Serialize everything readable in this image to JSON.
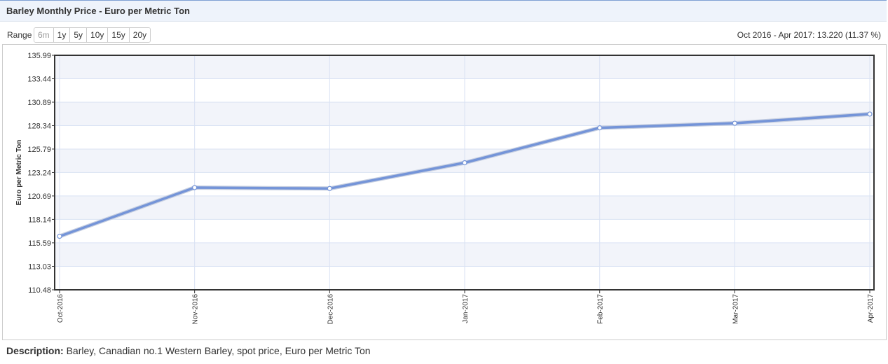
{
  "header": {
    "title": "Barley Monthly Price - Euro per Metric Ton"
  },
  "range": {
    "label": "Range",
    "buttons": [
      {
        "label": "6m",
        "enabled": false
      },
      {
        "label": "1y",
        "enabled": true
      },
      {
        "label": "5y",
        "enabled": true
      },
      {
        "label": "10y",
        "enabled": true
      },
      {
        "label": "15y",
        "enabled": true
      },
      {
        "label": "20y",
        "enabled": true
      }
    ]
  },
  "summary": "Oct 2016 - Apr 2017: 13.220 (11.37 %)",
  "description": {
    "label": "Description:",
    "text": " Barley, Canadian no.1 Western Barley, spot price, Euro per Metric Ton"
  },
  "colors": {
    "line": "#7494d8",
    "band": "#f2f4fa",
    "grid": "#d9e2f3",
    "axis": "#333333"
  },
  "chart_data": {
    "type": "line",
    "title": "Barley Monthly Price - Euro per Metric Ton",
    "xlabel": "",
    "ylabel": "Euro per Metric Ton",
    "categories": [
      "Oct-2016",
      "Nov-2016",
      "Dec-2016",
      "Jan-2017",
      "Feb-2017",
      "Mar-2017",
      "Apr-2017"
    ],
    "series": [
      {
        "values": [
          116.3,
          121.6,
          121.5,
          124.3,
          128.1,
          128.6,
          129.6
        ]
      }
    ],
    "ylim": [
      110.48,
      135.99
    ],
    "yticks": [
      "110.48",
      "113.03",
      "115.59",
      "118.14",
      "120.69",
      "123.24",
      "125.79",
      "128.34",
      "130.89",
      "133.44",
      "135.99"
    ],
    "grid": true,
    "alternating_bands": true,
    "legend": "none"
  }
}
